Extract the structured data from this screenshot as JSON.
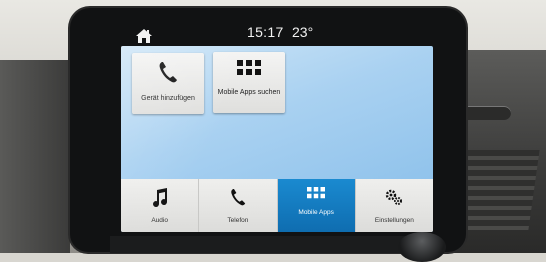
{
  "status": {
    "time": "15:17",
    "temperature": "23°",
    "home_icon": "home-icon"
  },
  "tiles": [
    {
      "label": "Gerät hinzufügen",
      "icon": "phone-icon"
    },
    {
      "label": "Mobile Apps suchen",
      "icon": "apps-grid-icon"
    }
  ],
  "nav": {
    "items": [
      {
        "label": "Audio",
        "icon": "music-note-icon",
        "active": false
      },
      {
        "label": "Telefon",
        "icon": "phone-icon",
        "active": false
      },
      {
        "label": "Mobile Apps",
        "icon": "apps-grid-icon",
        "active": true
      },
      {
        "label": "Einstellungen",
        "icon": "gears-icon",
        "active": false
      }
    ]
  },
  "colors": {
    "active_tab": "#1a8ad0",
    "screen_bg": "#a9d1f1",
    "bezel": "#111213"
  }
}
